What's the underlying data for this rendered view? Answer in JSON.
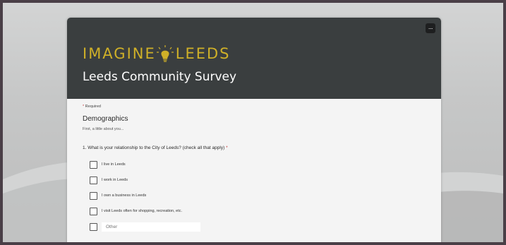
{
  "header": {
    "logo_left": "IMAGINE",
    "logo_right": "LEEDS",
    "title": "Leeds Community Survey",
    "more_label": "..."
  },
  "form": {
    "required_marker": "*",
    "required_note": "Required",
    "section_title": "Demographics",
    "section_desc": "First, a little about you...",
    "question": "1. What is your relationship to the City of Leeds? (check all that apply)",
    "question_required": "*",
    "options": [
      {
        "label": "I live in Leeds",
        "checked": false
      },
      {
        "label": "I work in Leeds",
        "checked": false
      },
      {
        "label": "I own a business in Leeds",
        "checked": false
      },
      {
        "label": "I visit Leeds often for shopping, recreation, etc.",
        "checked": false
      }
    ],
    "other_placeholder": "Other",
    "other_value": ""
  },
  "colors": {
    "banner": "#3a3e3f",
    "logo_gold": "#cfb028",
    "required_red": "#c43a3a",
    "card_bg": "#f4f4f4"
  },
  "icons": [
    "more-options-icon",
    "lightbulb-logo-icon",
    "checkbox-icon"
  ]
}
